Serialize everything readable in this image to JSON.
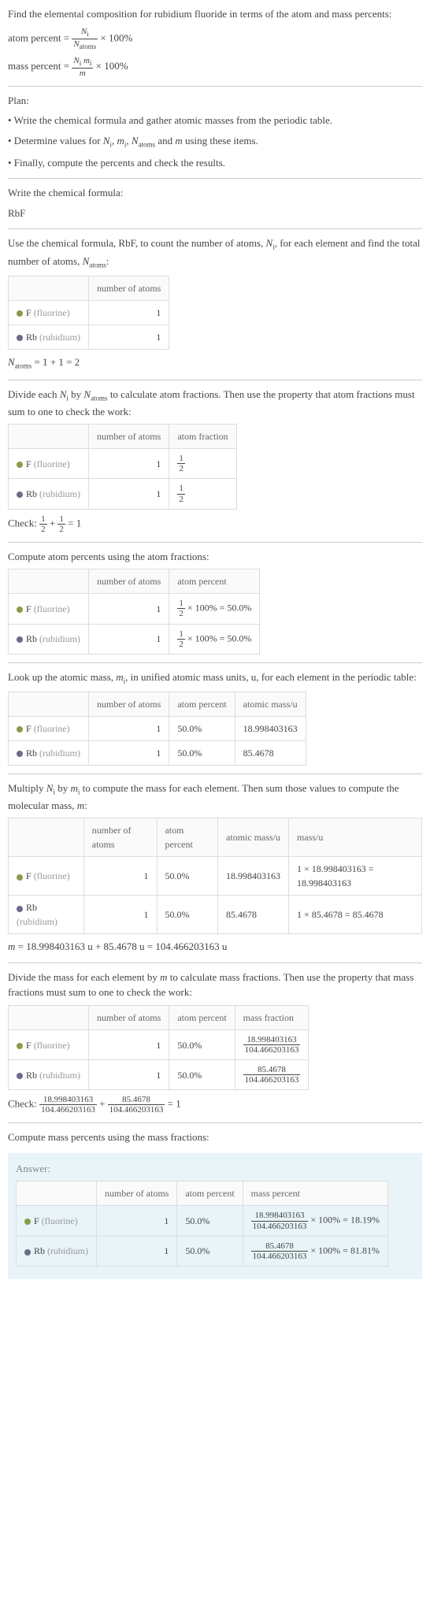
{
  "intro": {
    "heading": "Find the elemental composition for rubidium fluoride in terms of the atom and mass percents:",
    "atom_percent_eq": "atom percent = (N_i / N_atoms) × 100%",
    "mass_percent_eq": "mass percent = (N_i m_i / m) × 100%"
  },
  "plan": {
    "heading": "Plan:",
    "b1": "• Write the chemical formula and gather atomic masses from the periodic table.",
    "b2": "• Determine values for N_i, m_i, N_atoms and m using these items.",
    "b3": "• Finally, compute the percents and check the results."
  },
  "formula": {
    "heading": "Write the chemical formula:",
    "value": "RbF"
  },
  "count_atoms": {
    "heading": "Use the chemical formula, RbF, to count the number of atoms, N_i, for each element and find the total number of atoms, N_atoms:",
    "col_num": "number of atoms",
    "f_label": "F",
    "f_paren": " (fluorine)",
    "f_n": "1",
    "rb_label": "Rb",
    "rb_paren": " (rubidium)",
    "rb_n": "1",
    "total_eq": "N_atoms = 1 + 1 = 2"
  },
  "atom_fractions": {
    "heading": "Divide each N_i by N_atoms to calculate atom fractions. Then use the property that atom fractions must sum to one to check the work:",
    "col_num": "number of atoms",
    "col_frac": "atom fraction",
    "f_n": "1",
    "f_frac_num": "1",
    "f_frac_den": "2",
    "rb_n": "1",
    "rb_frac_num": "1",
    "rb_frac_den": "2",
    "check": "Check: 1/2 + 1/2 = 1"
  },
  "atom_percents": {
    "heading": "Compute atom percents using the atom fractions:",
    "col_num": "number of atoms",
    "col_pct": "atom percent",
    "f_n": "1",
    "f_pct": "× 100% = 50.0%",
    "rb_n": "1",
    "rb_pct": "× 100% = 50.0%"
  },
  "atomic_mass": {
    "heading": "Look up the atomic mass, m_i, in unified atomic mass units, u, for each element in the periodic table:",
    "col_num": "number of atoms",
    "col_pct": "atom percent",
    "col_mass": "atomic mass/u",
    "f_n": "1",
    "f_pct": "50.0%",
    "f_mass": "18.998403163",
    "rb_n": "1",
    "rb_pct": "50.0%",
    "rb_mass": "85.4678"
  },
  "mass_calc": {
    "heading": "Multiply N_i by m_i to compute the mass for each element. Then sum those values to compute the molecular mass, m:",
    "col_num": "number of atoms",
    "col_pct": "atom percent",
    "col_mass": "atomic mass/u",
    "col_massu": "mass/u",
    "f_n": "1",
    "f_pct": "50.0%",
    "f_mass": "18.998403163",
    "f_massu": "1 × 18.998403163 = 18.998403163",
    "rb_n": "1",
    "rb_pct": "50.0%",
    "rb_mass": "85.4678",
    "rb_massu": "1 × 85.4678 = 85.4678",
    "total": "m = 18.998403163 u + 85.4678 u = 104.466203163 u"
  },
  "mass_fractions": {
    "heading": "Divide the mass for each element by m to calculate mass fractions. Then use the property that mass fractions must sum to one to check the work:",
    "col_num": "number of atoms",
    "col_pct": "atom percent",
    "col_mfrac": "mass fraction",
    "f_n": "1",
    "f_pct": "50.0%",
    "f_mfrac_num": "18.998403163",
    "f_mfrac_den": "104.466203163",
    "rb_n": "1",
    "rb_pct": "50.0%",
    "rb_mfrac_num": "85.4678",
    "rb_mfrac_den": "104.466203163",
    "check_label": "Check: ",
    "check_eq": " = 1"
  },
  "mass_percents": {
    "heading": "Compute mass percents using the mass fractions:"
  },
  "answer": {
    "label": "Answer:",
    "col_num": "number of atoms",
    "col_pct": "atom percent",
    "col_mpct": "mass percent",
    "f_n": "1",
    "f_pct": "50.0%",
    "f_mpct_num": "18.998403163",
    "f_mpct_den": "104.466203163",
    "f_mpct_res": "× 100% = 18.19%",
    "rb_n": "1",
    "rb_pct": "50.0%",
    "rb_mpct_num": "85.4678",
    "rb_mpct_den": "104.466203163",
    "rb_mpct_res": "× 100% = 81.81%"
  },
  "chart_data": {
    "type": "table",
    "title": "Elemental composition of RbF",
    "columns": [
      "element",
      "number_of_atoms",
      "atom_percent",
      "atomic_mass_u",
      "mass_u",
      "mass_percent"
    ],
    "rows": [
      {
        "element": "F (fluorine)",
        "number_of_atoms": 1,
        "atom_percent": 50.0,
        "atomic_mass_u": 18.998403163,
        "mass_u": 18.998403163,
        "mass_percent": 18.19
      },
      {
        "element": "Rb (rubidium)",
        "number_of_atoms": 1,
        "atom_percent": 50.0,
        "atomic_mass_u": 85.4678,
        "mass_u": 85.4678,
        "mass_percent": 81.81
      }
    ],
    "totals": {
      "N_atoms": 2,
      "molecular_mass_u": 104.466203163
    }
  }
}
